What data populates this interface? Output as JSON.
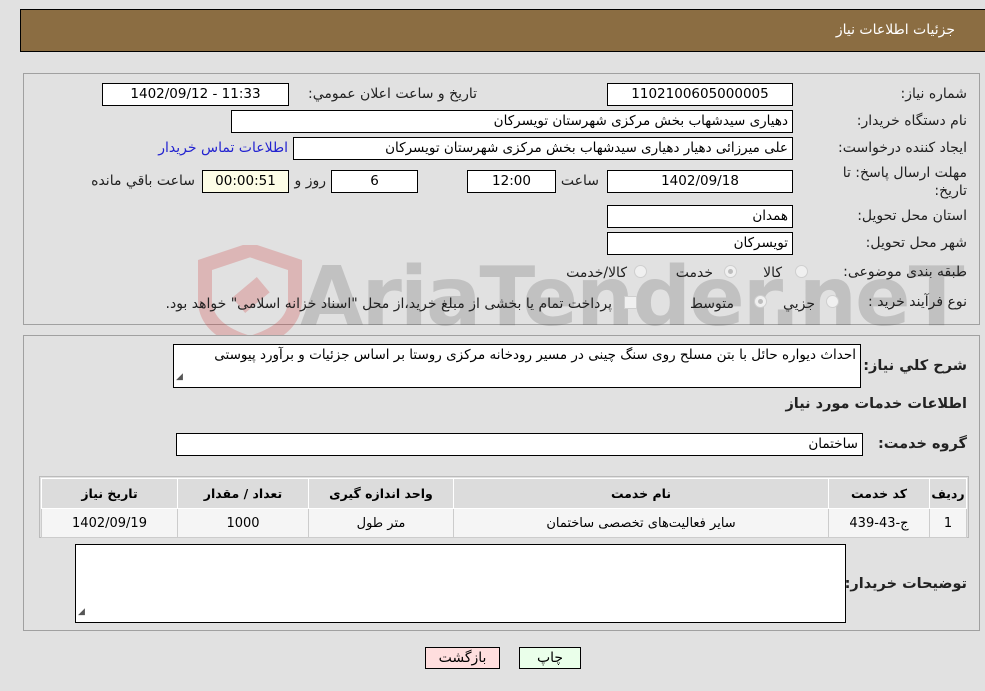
{
  "header": {
    "title": "جزئیات اطلاعات نیاز"
  },
  "form": {
    "need_number_label": "شماره نیاز:",
    "need_number": "1102100605000005",
    "announce_label": "تاریخ و ساعت اعلان عمومي:",
    "announce_value": "1402/09/12 - 11:33",
    "buyer_org_label": "نام دستگاه خریدار:",
    "buyer_org": "دهیاری سیدشهاب بخش مرکزی شهرستان تویسرکان",
    "creator_label": "ایجاد کننده درخواست:",
    "creator": "علی میرزائی دهیار دهیاری سیدشهاب بخش مرکزی شهرستان تویسرکان",
    "contact_link": "اطلاعات تماس خریدار",
    "deadline_label_line1": "مهلت ارسال پاسخ: تا",
    "deadline_label_line2": "تاریخ:",
    "deadline_date": "1402/09/18",
    "time_label": "ساعت",
    "deadline_time": "12:00",
    "days_value": "6",
    "days_label": "روز و",
    "remaining_time": "00:00:51",
    "remaining_label": "ساعت باقي مانده",
    "province_label": "استان محل تحویل:",
    "province": "همدان",
    "city_label": "شهر محل تحویل:",
    "city": "تویسرکان",
    "category_label": "طبقه بندی موضوعی:",
    "category_options": [
      {
        "label": "کالا",
        "selected": false
      },
      {
        "label": "خدمت",
        "selected": true
      },
      {
        "label": "کالا/خدمت",
        "selected": false
      }
    ],
    "process_label": "نوع فرآیند خرید :",
    "process_options": [
      {
        "label": "جزيي",
        "selected": false
      },
      {
        "label": "متوسط",
        "selected": true
      }
    ],
    "treasury_note": "پرداخت تمام یا بخشی از مبلغ خرید،از محل \"اسناد خزانه اسلامی\" خواهد بود.",
    "treasury_checked": false
  },
  "description": {
    "label": "شرح کلي نیاز:",
    "text": "احداث دیواره حائل با بتن مسلح روی سنگ چینی در مسیر رودخانه مرکزی روستا بر اساس جزئیات و برآورد پیوستی"
  },
  "services": {
    "section_title": "اطلاعات خدمات مورد نیاز",
    "group_label": "گروه خدمت:",
    "group_value": "ساختمان",
    "columns": [
      "ردیف",
      "کد خدمت",
      "نام خدمت",
      "واحد اندازه گیری",
      "تعداد / مقدار",
      "تاریخ نیاز"
    ],
    "rows": [
      [
        "1",
        "ج-43-439",
        "سایر فعالیت‌های تخصصی ساختمان",
        "متر طول",
        "1000",
        "1402/09/19"
      ]
    ]
  },
  "buyer_notes": {
    "label": "توضیحات خریدار:",
    "value": ""
  },
  "buttons": {
    "print": "چاپ",
    "back": "بازگشت"
  },
  "watermark": {
    "text": "AriaTender.neT"
  },
  "colors": {
    "header_bg": "#8b6d42",
    "print_bg": "#eaffea",
    "back_bg": "#ffdede",
    "link": "#2323d0"
  }
}
